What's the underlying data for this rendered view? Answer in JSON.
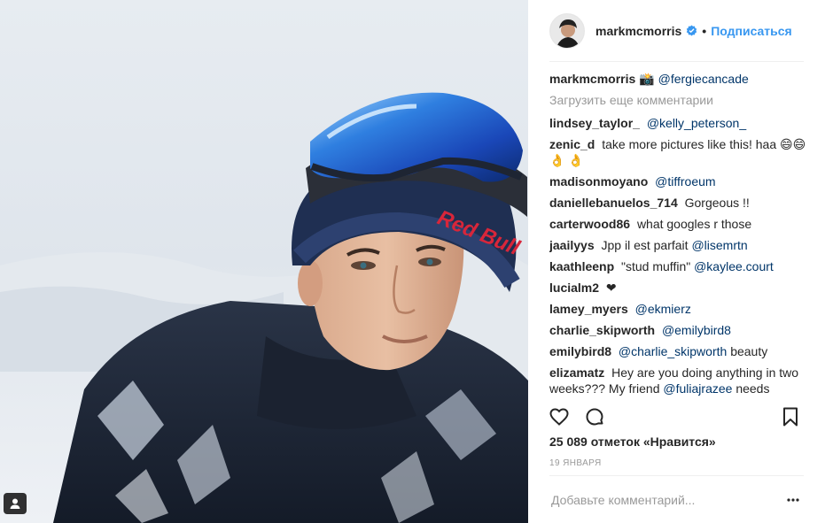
{
  "post": {
    "author": "markmcmorris",
    "follow_label": "Подписаться",
    "separator": "•",
    "caption_emoji": "📸",
    "caption_mention": "@fergiecancade",
    "load_more": "Загрузить еще комментарии",
    "comments": [
      {
        "user": "lindsey_taylor_",
        "text": "",
        "mention": "@kelly_peterson_"
      },
      {
        "user": "zenic_d",
        "text": "take more pictures like this! haa 😄😄 👌 👌",
        "mention": ""
      },
      {
        "user": "madisonmoyano",
        "text": "",
        "mention": "@tiffroeum"
      },
      {
        "user": "daniellebanuelos_714",
        "text": "Gorgeous !!",
        "mention": ""
      },
      {
        "user": "carterwood86",
        "text": "what googles r those",
        "mention": ""
      },
      {
        "user": "jaailyys",
        "text": "Jpp il est parfait",
        "mention": "@lisemrtn"
      },
      {
        "user": "kaathleenp",
        "text": "\"stud muffin\"",
        "mention": "@kaylee.court"
      },
      {
        "user": "lucialm2",
        "text": "❤",
        "mention": ""
      },
      {
        "user": "lamey_myers",
        "text": "",
        "mention": "@ekmierz"
      },
      {
        "user": "charlie_skipworth",
        "text": "",
        "mention": "@emilybird8"
      },
      {
        "user": "emilybird8",
        "text": "",
        "mention": "@charlie_skipworth",
        "after": "beauty"
      },
      {
        "user": "elizamatz",
        "text": "Hey are you doing anything in two weeks??? My friend",
        "mention": "@fuliajrazee",
        "after": "needs"
      }
    ],
    "likes": "25 089 отметок «Нравится»",
    "date": "19 января",
    "comment_placeholder": "Добавьте комментарий...",
    "more_label": "•••"
  },
  "icons": {
    "verified": "verified-badge-icon",
    "like": "heart-icon",
    "comment": "comment-bubble-icon",
    "save": "bookmark-icon",
    "tag": "user-tag-icon",
    "more": "more-options-icon"
  },
  "colors": {
    "link": "#3897f0",
    "mention": "#003569",
    "muted": "#999999",
    "text": "#262626"
  }
}
